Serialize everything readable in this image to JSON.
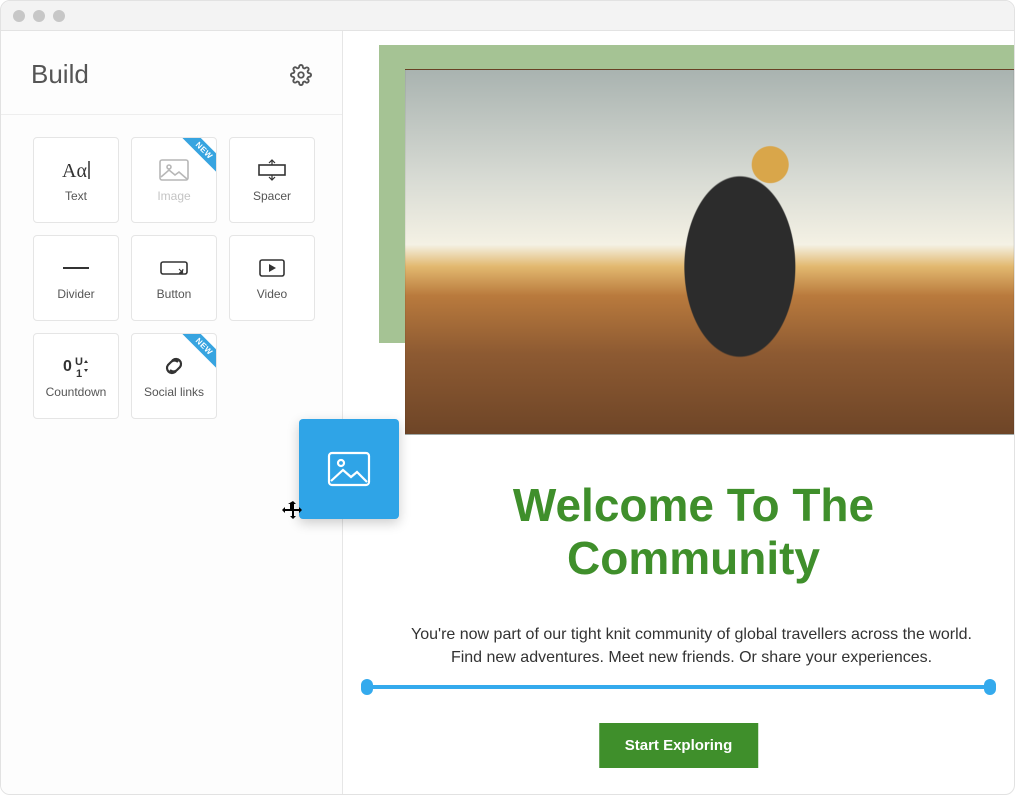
{
  "sidebar": {
    "title": "Build",
    "blocks": [
      {
        "label": "Text",
        "icon": "text-icon",
        "new": false
      },
      {
        "label": "Image",
        "icon": "image-icon",
        "new": true
      },
      {
        "label": "Spacer",
        "icon": "spacer-icon",
        "new": false
      },
      {
        "label": "Divider",
        "icon": "divider-icon",
        "new": false
      },
      {
        "label": "Button",
        "icon": "button-icon",
        "new": false
      },
      {
        "label": "Video",
        "icon": "video-icon",
        "new": false
      },
      {
        "label": "Countdown",
        "icon": "countdown-icon",
        "new": false
      },
      {
        "label": "Social links",
        "icon": "link-icon",
        "new": true
      }
    ],
    "ribbon_label": "NEW"
  },
  "canvas": {
    "headline": "Welcome To The Community",
    "subtext": "You're now part of our tight knit community of global travellers across the world. Find new adventures. Meet new friends. Or share your experiences.",
    "cta_label": "Start Exploring"
  },
  "drag": {
    "block": "image-icon"
  },
  "colors": {
    "accent_blue": "#2fa4e7",
    "brand_green": "#3f8f2b",
    "hero_green": "#a5c394"
  }
}
